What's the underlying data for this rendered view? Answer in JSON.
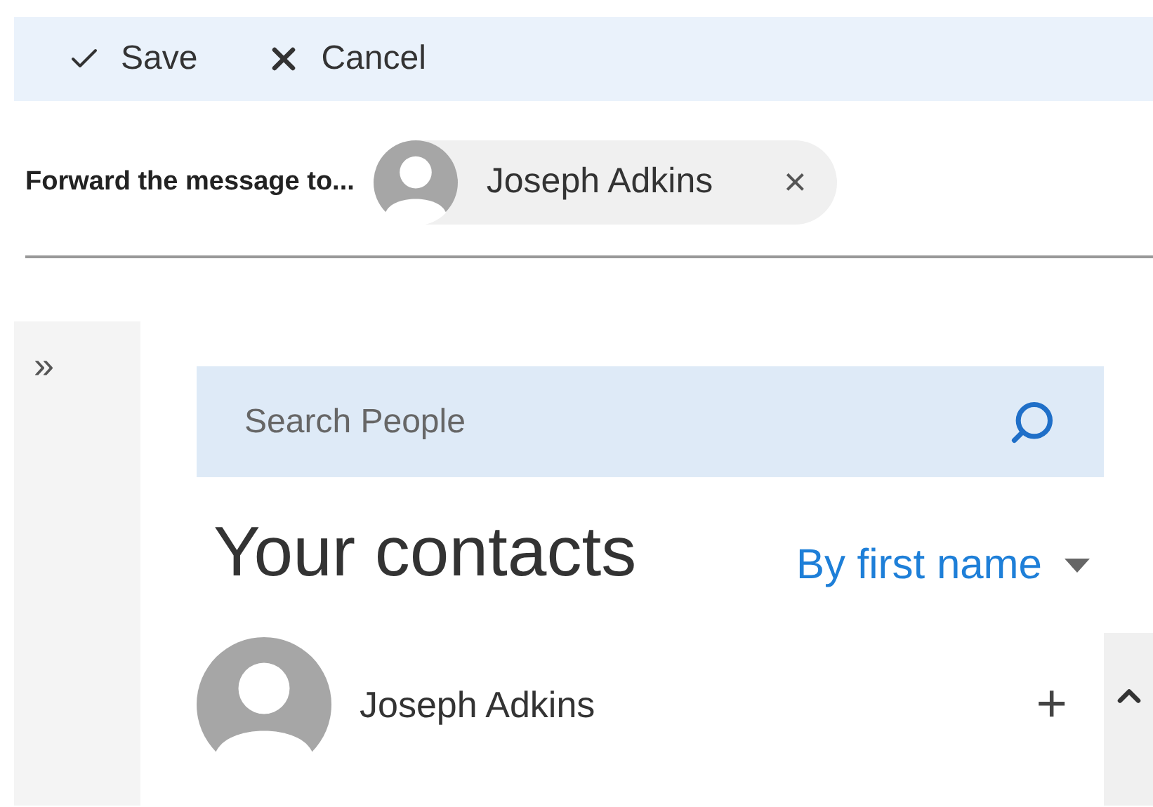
{
  "toolbar": [
    {
      "kind": "save",
      "label": "Save"
    },
    {
      "kind": "cancel",
      "label": "Cancel"
    }
  ],
  "forward": {
    "label": "Forward the message to...",
    "recipients": [
      {
        "name": "Joseph Adkins",
        "remove": "×"
      }
    ]
  },
  "sidebar": {
    "toggle": "»"
  },
  "search": {
    "placeholder": "Search People"
  },
  "contacts": {
    "title": "Your contacts",
    "sort": "By first name",
    "items": [
      {
        "name": "Joseph Adkins",
        "add": "+"
      }
    ]
  }
}
